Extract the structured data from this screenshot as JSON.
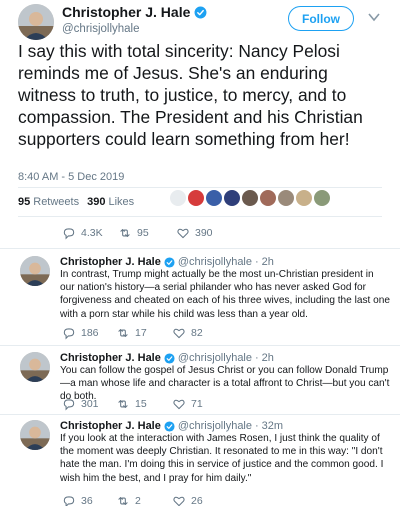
{
  "main_tweet": {
    "author_name": "Christopher J. Hale",
    "handle": "@chrisjollyhale",
    "follow_label": "Follow",
    "text": "I say this with total sincerity: Nancy Pelosi reminds me of Jesus. She's an enduring witness to truth, to justice, to mercy, and to compassion. The President and his Christian supporters could learn something from her!",
    "timestamp": "8:40 AM - 5 Dec 2019",
    "retweets_count": "95",
    "retweets_label": "Retweets",
    "likes_count": "390",
    "likes_label": "Likes",
    "actions": {
      "replies": "4.3K",
      "retweets": "95",
      "likes": "390"
    }
  },
  "replies": [
    {
      "author_name": "Christopher J. Hale",
      "handle": "@chrisjollyhale",
      "age": "2h",
      "text": "In contrast, Trump might actually be the most un-Christian president in our nation's history—a serial philander who has never asked God for forgiveness and cheated on each of his three wives, including the last one with a porn star while his child was less than a year old.",
      "actions": {
        "replies": "186",
        "retweets": "17",
        "likes": "82"
      }
    },
    {
      "author_name": "Christopher J. Hale",
      "handle": "@chrisjollyhale",
      "age": "2h",
      "text": "You can follow the gospel of Jesus Christ or you can follow Donald Trump—a man whose life and character is a total affront to Christ—but you can't do both.",
      "actions": {
        "replies": "301",
        "retweets": "15",
        "likes": "71"
      }
    },
    {
      "author_name": "Christopher J. Hale",
      "handle": "@chrisjollyhale",
      "age": "32m",
      "text": "If you look at the interaction with James Rosen, I just think the quality of the moment was deeply Christian. It resonated to me in this way: \"I don't hate the man. I'm doing this in service of justice and the common good. I wish him the best, and I pray for him daily.\"",
      "actions": {
        "replies": "36",
        "retweets": "2",
        "likes": "26"
      }
    }
  ],
  "colors": {
    "accent": "#1da1f2",
    "secondary_text": "#657786",
    "primary_text": "#14171a",
    "divider": "#e6ecf0"
  },
  "icons": [
    "verified-badge-icon",
    "chevron-down-icon",
    "reply-icon",
    "retweet-icon",
    "like-icon"
  ]
}
